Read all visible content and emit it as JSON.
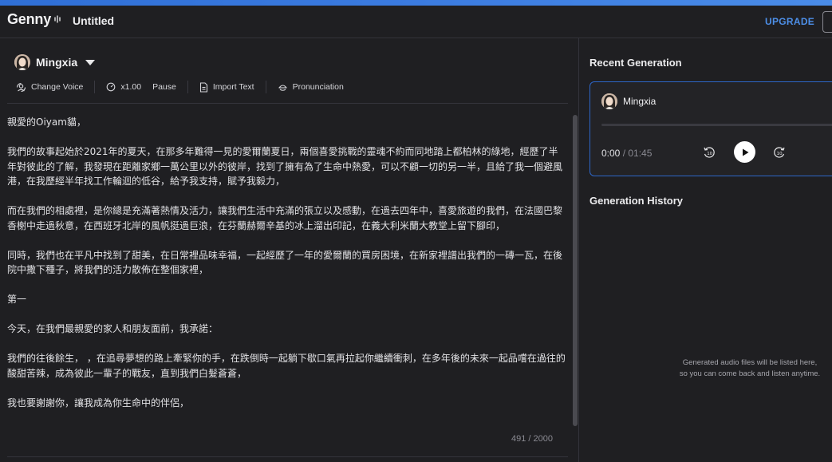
{
  "app": {
    "logo": "Genny",
    "doc_title": "Untitled",
    "upgrade_label": "UPGRADE"
  },
  "editor": {
    "voice_name": "Mingxia",
    "toolbar": {
      "change_voice": "Change Voice",
      "speed": "x1.00",
      "pause": "Pause",
      "import_text": "Import Text",
      "pronunciation": "Pronunciation"
    },
    "paragraphs": [
      "親愛的Oiyam貓，",
      "我們的故事起始於2021年的夏天，在那多年難得一見的愛爾蘭夏日，兩個喜愛挑戰的靈魂不約而同地踏上都柏林的綠地，經歷了半年對彼此的了解，我發現在距離家鄉一萬公里以外的彼岸，找到了擁有為了生命中熱愛，可以不顧一切的另一半，且給了我一個避風港，在我歷經半年找工作輪迴的低谷，給予我支持，賦予我毅力，",
      "而在我們的相處裡，是你總是充滿著熱情及活力，讓我們生活中充滿的張立以及感動，在過去四年中，喜愛旅遊的我們，在法國巴黎香榭中走過秋意，在西班牙北岸的風帆挺過巨浪，在芬蘭赫爾辛基的冰上溜出印記，在義大利米蘭大教堂上留下腳印，",
      "同時，我們也在平凡中找到了甜美，在日常裡品味幸福，一起經歷了一年的愛爾蘭的買房困境，在新家裡譜出我們的一磚一瓦，在後院中撒下種子，將我們的活力散佈在整個家裡，",
      "第一",
      "今天，在我們最親愛的家人和朋友面前，我承諾：",
      "我們的往後餘生，  ，在追尋夢想的路上牽緊你的手，在跌倒時一起躺下歇口氣再拉起你繼續衝刺，在多年後的未來一起品嚐在過往的酸甜苦辣，成為彼此一輩子的戰友，直到我們白髮蒼蒼，",
      "我也要謝謝你，讓我成為你生命中的伴侶，"
    ],
    "char_count": "491",
    "char_max": " / 2000"
  },
  "right_panel": {
    "recent_title": "Recent Generation",
    "player": {
      "voice_name": "Mingxia",
      "current_time": "0:00",
      "total_time": " / 01:45",
      "progress": 0
    },
    "history_title": "Generation History",
    "empty_line1": "Generated audio files will be listed here,",
    "empty_line2": "so you can come back and listen anytime."
  },
  "colors": {
    "background": "#1f1f22",
    "accent": "#4d8fe8",
    "card_border": "#2d66c8"
  }
}
